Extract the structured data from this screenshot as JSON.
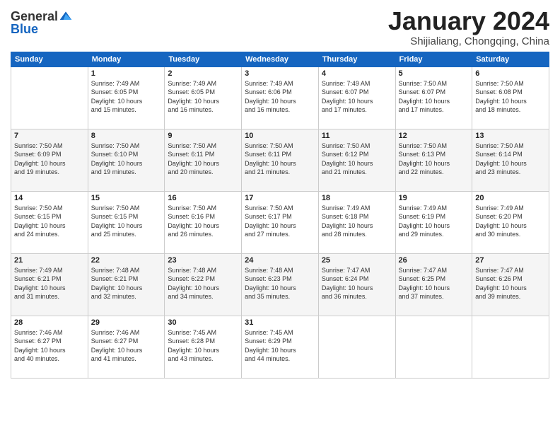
{
  "logo": {
    "general": "General",
    "blue": "Blue"
  },
  "title": "January 2024",
  "subtitle": "Shijialiang, Chongqing, China",
  "header_days": [
    "Sunday",
    "Monday",
    "Tuesday",
    "Wednesday",
    "Thursday",
    "Friday",
    "Saturday"
  ],
  "weeks": [
    [
      {
        "day": "",
        "info": ""
      },
      {
        "day": "1",
        "info": "Sunrise: 7:49 AM\nSunset: 6:05 PM\nDaylight: 10 hours\nand 15 minutes."
      },
      {
        "day": "2",
        "info": "Sunrise: 7:49 AM\nSunset: 6:05 PM\nDaylight: 10 hours\nand 16 minutes."
      },
      {
        "day": "3",
        "info": "Sunrise: 7:49 AM\nSunset: 6:06 PM\nDaylight: 10 hours\nand 16 minutes."
      },
      {
        "day": "4",
        "info": "Sunrise: 7:49 AM\nSunset: 6:07 PM\nDaylight: 10 hours\nand 17 minutes."
      },
      {
        "day": "5",
        "info": "Sunrise: 7:50 AM\nSunset: 6:07 PM\nDaylight: 10 hours\nand 17 minutes."
      },
      {
        "day": "6",
        "info": "Sunrise: 7:50 AM\nSunset: 6:08 PM\nDaylight: 10 hours\nand 18 minutes."
      }
    ],
    [
      {
        "day": "7",
        "info": "Sunrise: 7:50 AM\nSunset: 6:09 PM\nDaylight: 10 hours\nand 19 minutes."
      },
      {
        "day": "8",
        "info": "Sunrise: 7:50 AM\nSunset: 6:10 PM\nDaylight: 10 hours\nand 19 minutes."
      },
      {
        "day": "9",
        "info": "Sunrise: 7:50 AM\nSunset: 6:11 PM\nDaylight: 10 hours\nand 20 minutes."
      },
      {
        "day": "10",
        "info": "Sunrise: 7:50 AM\nSunset: 6:11 PM\nDaylight: 10 hours\nand 21 minutes."
      },
      {
        "day": "11",
        "info": "Sunrise: 7:50 AM\nSunset: 6:12 PM\nDaylight: 10 hours\nand 21 minutes."
      },
      {
        "day": "12",
        "info": "Sunrise: 7:50 AM\nSunset: 6:13 PM\nDaylight: 10 hours\nand 22 minutes."
      },
      {
        "day": "13",
        "info": "Sunrise: 7:50 AM\nSunset: 6:14 PM\nDaylight: 10 hours\nand 23 minutes."
      }
    ],
    [
      {
        "day": "14",
        "info": "Sunrise: 7:50 AM\nSunset: 6:15 PM\nDaylight: 10 hours\nand 24 minutes."
      },
      {
        "day": "15",
        "info": "Sunrise: 7:50 AM\nSunset: 6:15 PM\nDaylight: 10 hours\nand 25 minutes."
      },
      {
        "day": "16",
        "info": "Sunrise: 7:50 AM\nSunset: 6:16 PM\nDaylight: 10 hours\nand 26 minutes."
      },
      {
        "day": "17",
        "info": "Sunrise: 7:50 AM\nSunset: 6:17 PM\nDaylight: 10 hours\nand 27 minutes."
      },
      {
        "day": "18",
        "info": "Sunrise: 7:49 AM\nSunset: 6:18 PM\nDaylight: 10 hours\nand 28 minutes."
      },
      {
        "day": "19",
        "info": "Sunrise: 7:49 AM\nSunset: 6:19 PM\nDaylight: 10 hours\nand 29 minutes."
      },
      {
        "day": "20",
        "info": "Sunrise: 7:49 AM\nSunset: 6:20 PM\nDaylight: 10 hours\nand 30 minutes."
      }
    ],
    [
      {
        "day": "21",
        "info": "Sunrise: 7:49 AM\nSunset: 6:21 PM\nDaylight: 10 hours\nand 31 minutes."
      },
      {
        "day": "22",
        "info": "Sunrise: 7:48 AM\nSunset: 6:21 PM\nDaylight: 10 hours\nand 32 minutes."
      },
      {
        "day": "23",
        "info": "Sunrise: 7:48 AM\nSunset: 6:22 PM\nDaylight: 10 hours\nand 34 minutes."
      },
      {
        "day": "24",
        "info": "Sunrise: 7:48 AM\nSunset: 6:23 PM\nDaylight: 10 hours\nand 35 minutes."
      },
      {
        "day": "25",
        "info": "Sunrise: 7:47 AM\nSunset: 6:24 PM\nDaylight: 10 hours\nand 36 minutes."
      },
      {
        "day": "26",
        "info": "Sunrise: 7:47 AM\nSunset: 6:25 PM\nDaylight: 10 hours\nand 37 minutes."
      },
      {
        "day": "27",
        "info": "Sunrise: 7:47 AM\nSunset: 6:26 PM\nDaylight: 10 hours\nand 39 minutes."
      }
    ],
    [
      {
        "day": "28",
        "info": "Sunrise: 7:46 AM\nSunset: 6:27 PM\nDaylight: 10 hours\nand 40 minutes."
      },
      {
        "day": "29",
        "info": "Sunrise: 7:46 AM\nSunset: 6:27 PM\nDaylight: 10 hours\nand 41 minutes."
      },
      {
        "day": "30",
        "info": "Sunrise: 7:45 AM\nSunset: 6:28 PM\nDaylight: 10 hours\nand 43 minutes."
      },
      {
        "day": "31",
        "info": "Sunrise: 7:45 AM\nSunset: 6:29 PM\nDaylight: 10 hours\nand 44 minutes."
      },
      {
        "day": "",
        "info": ""
      },
      {
        "day": "",
        "info": ""
      },
      {
        "day": "",
        "info": ""
      }
    ]
  ]
}
